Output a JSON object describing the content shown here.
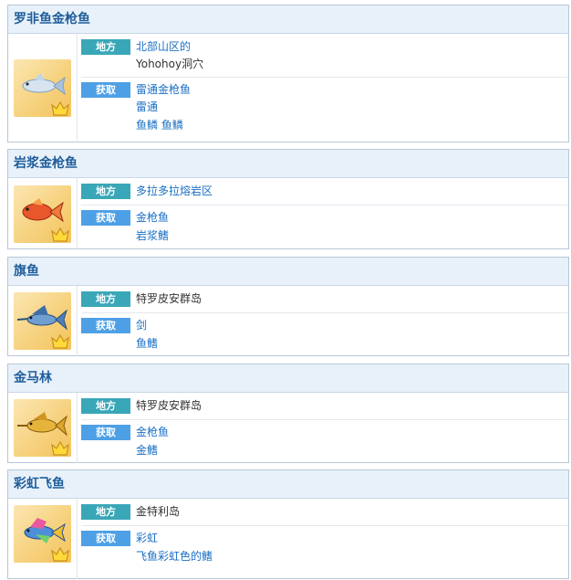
{
  "labels": {
    "place": "地方",
    "obtain": "获取"
  },
  "cards": [
    {
      "title": "罗非鱼金枪鱼",
      "fish_color": "#8fb3d8",
      "place": [
        "北部山区的",
        "Yohohoy洞穴"
      ],
      "obtain": [
        "雷通金枪鱼",
        "雷通",
        "鱼鳞 鱼鳞"
      ]
    },
    {
      "title": "岩浆金枪鱼",
      "fish_color": "#e0502a",
      "place": [
        "多拉多拉熔岩区"
      ],
      "obtain": [
        "金枪鱼",
        "岩浆鳍"
      ]
    },
    {
      "title": "旗鱼",
      "fish_color": "#5b8fc4",
      "place": [
        "特罗皮安群岛"
      ],
      "obtain": [
        "剑",
        "鱼鳍"
      ]
    },
    {
      "title": "金马林",
      "fish_color": "#d9a520",
      "place": [
        "特罗皮安群岛"
      ],
      "obtain": [
        "金枪鱼",
        "金鳍"
      ]
    },
    {
      "title": "彩虹飞鱼",
      "fish_color": "#3c7fd0",
      "place": [
        "金特利岛"
      ],
      "obtain": [
        "彩虹",
        "飞鱼彩虹色的鳍"
      ]
    }
  ]
}
